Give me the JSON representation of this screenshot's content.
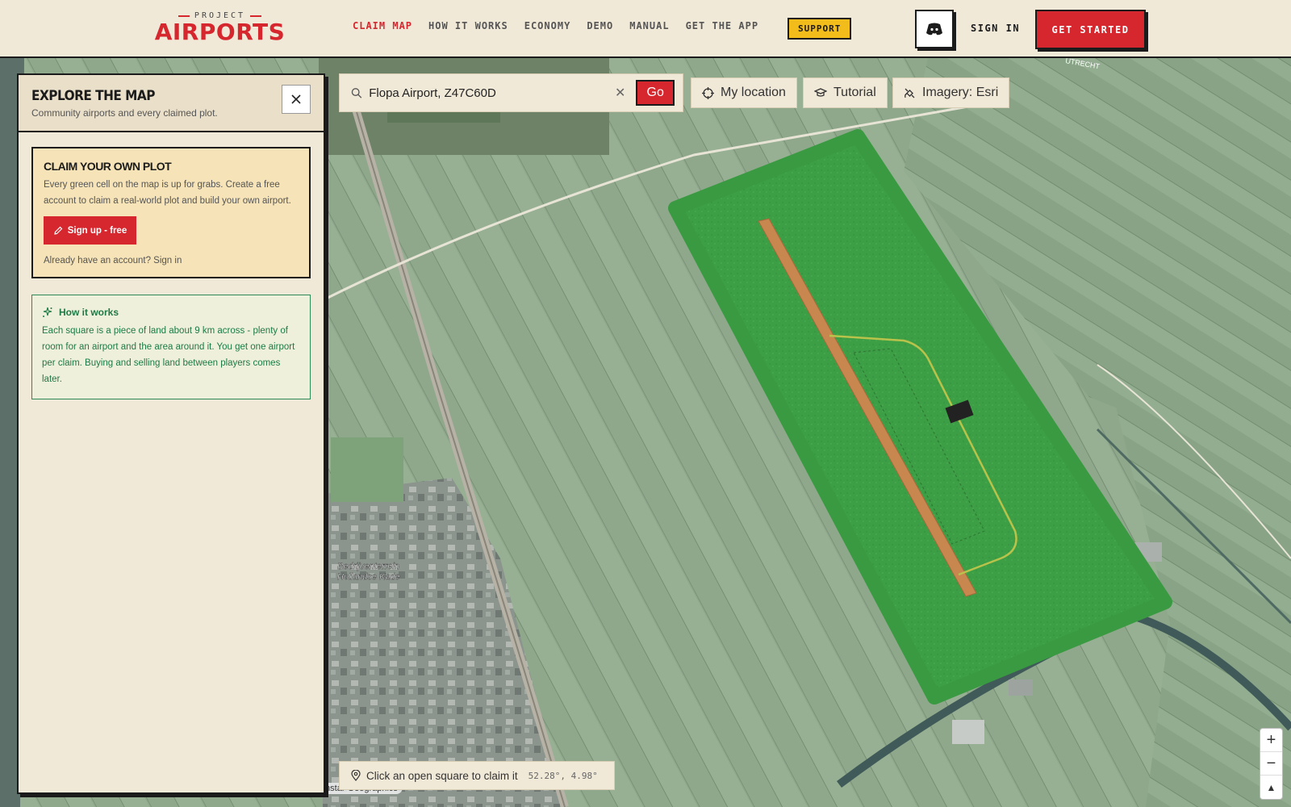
{
  "brand": {
    "tagline": "PROJECT",
    "name": "AIRPORTS",
    "accent": "#d6262e"
  },
  "nav": {
    "links": [
      "CLAIM MAP",
      "HOW IT WORKS",
      "ECONOMY",
      "DEMO",
      "MANUAL",
      "GET THE APP"
    ],
    "active": "CLAIM MAP",
    "support": "SUPPORT",
    "discord_icon": "discord-icon",
    "sign_in": "SIGN IN",
    "get_started": "GET STARTED"
  },
  "panel": {
    "title": "EXPLORE THE MAP",
    "subtitle": "Community airports and every claimed plot.",
    "claim": {
      "title": "CLAIM YOUR OWN PLOT",
      "text": "Every green cell on the map is up for grabs. Create a free account to claim a real-world plot and build your own airport.",
      "button": "Sign up - free",
      "footer": "Already have an account? Sign in"
    },
    "how": {
      "title": "How it works",
      "text": "Each square is a piece of land about 9 km across - plenty of room for an airport and the area around it. You get one airport per claim. Buying and selling land between players comes later."
    }
  },
  "search": {
    "value": "Flopa Airport, Z47C60D",
    "go": "Go"
  },
  "toolbar": {
    "my_location": "My location",
    "tutorial": "Tutorial",
    "imagery": "Imagery: Esri"
  },
  "map": {
    "label_business_park": [
      "Bedrijventerrein",
      "Hollandse Kade"
    ],
    "label_top": "UTRECHT",
    "attribution": "Instar Geographics"
  },
  "status": {
    "hint": "Click an open square to claim it",
    "coords": "52.28°, 4.98°"
  },
  "zoom": {
    "in": "+",
    "out": "−",
    "compass": "▲"
  }
}
